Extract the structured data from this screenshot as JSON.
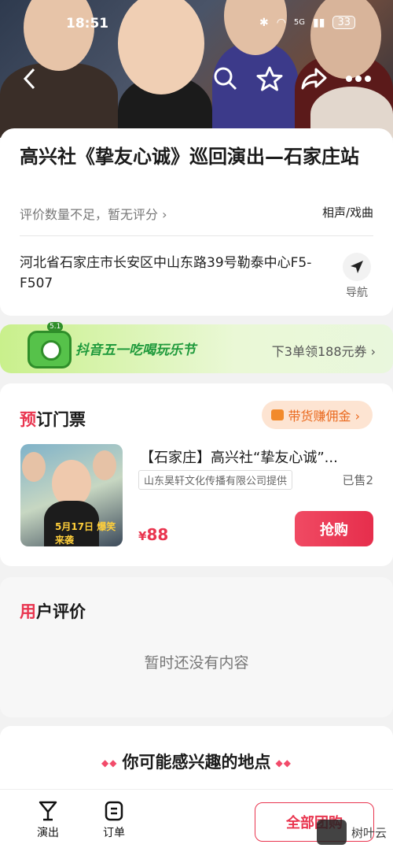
{
  "status_bar": {
    "time": "18:51",
    "network": "5G",
    "battery": "33"
  },
  "event": {
    "title": "高兴社《挚友心诚》巡回演出—石家庄站",
    "rating_text": "评价数量不足，暂无评分 ›",
    "category": "相声/戏曲",
    "address": "河北省石家庄市长安区中山东路39号勒泰中心F5-F507",
    "nav_label": "导航"
  },
  "banner": {
    "badge": "5.1",
    "title": "抖音五一吃喝玩乐节",
    "subtitle": "下3单领188元券 ›"
  },
  "tickets": {
    "title_first": "预",
    "title_rest": "订门票",
    "commission_label": "带货赚佣金 ›",
    "product": {
      "name": "【石家庄】高兴社“挚友心诚”...",
      "provider": "山东昊轩文化传播有限公司提供",
      "sold": "已售2",
      "price_symbol": "¥",
      "price": "88",
      "buy_label": "抢购",
      "thumb_text": "5月17日 爆笑来袭"
    }
  },
  "reviews": {
    "title_first": "用",
    "title_rest": "户评价",
    "empty_text": "暂时还没有内容"
  },
  "interest": {
    "title": "你可能感兴趣的地点"
  },
  "tabbar": {
    "tabs": [
      {
        "label": "演出"
      },
      {
        "label": "订单"
      }
    ],
    "all_button": "全部团购",
    "watermark": "树叶云"
  },
  "colors": {
    "accent": "#e9354f",
    "commission": "#ea6a1f",
    "banner_green": "#1f9a3c"
  }
}
